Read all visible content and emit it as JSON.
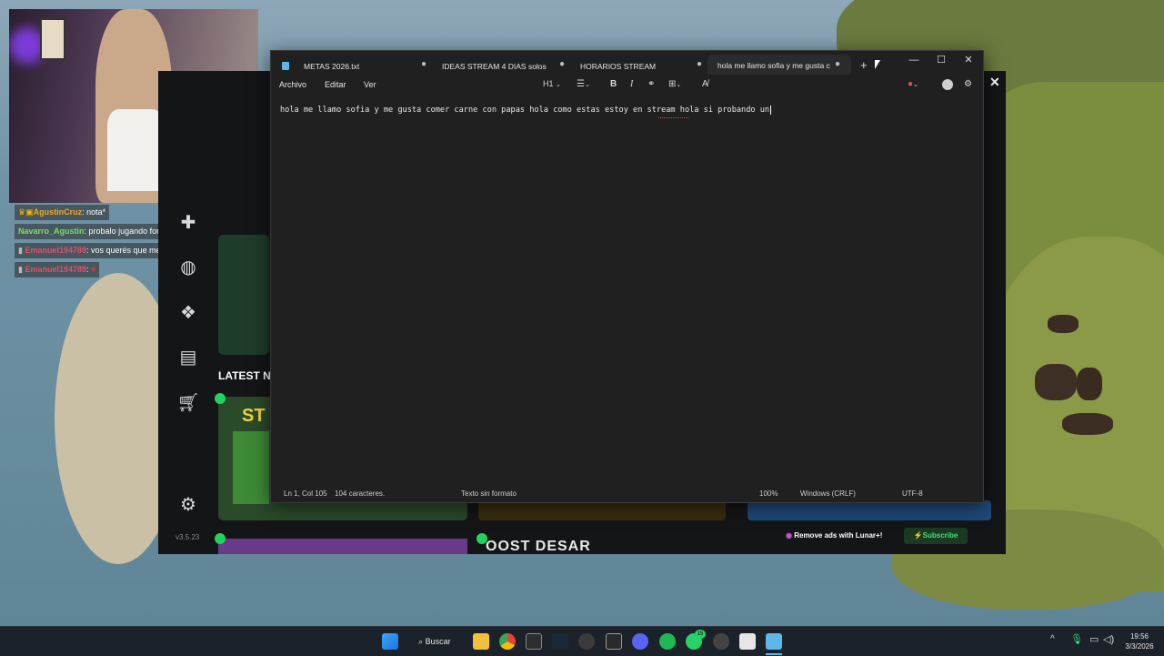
{
  "chat": {
    "messages": [
      {
        "user": "AgustinCruz",
        "text": "nota*"
      },
      {
        "user": "Navarro_Agustin",
        "text": "probalo jugando fornite..."
      },
      {
        "user": "Emanuel194789",
        "text": "vos querés que me duerma?"
      },
      {
        "user": "Emanuel194789",
        "text": ""
      }
    ]
  },
  "launcher": {
    "latest_label": "LATEST N",
    "version": "v3.5.23",
    "remove_ads": "Remove ads with Lunar+!",
    "subscribe": "Subscribe",
    "banner_text": "ST",
    "bottom_text": "OOST DESAR"
  },
  "notepad": {
    "tabs": [
      {
        "label": "METAS 2026.txt"
      },
      {
        "label": "IDEAS STREAM 4 DIAS solos"
      },
      {
        "label": "HORARIOS STREAM"
      },
      {
        "label": "hola me llamo sofia y me gusta c"
      }
    ],
    "menu": {
      "file": "Archivo",
      "edit": "Editar",
      "view": "Ver"
    },
    "toolbar": {
      "heading": "H1"
    },
    "content": "hola me llamo sofia y me gusta comer carne con papas hola como estas estoy en stream hola si probando un",
    "status": {
      "position": "Ln 1, Col 105",
      "chars": "104 caracteres.",
      "format": "Texto sin formato",
      "zoom": "100%",
      "line_ending": "Windows (CRLF)",
      "encoding": "UTF-8"
    }
  },
  "taskbar": {
    "search": "Buscar",
    "time": "19:56",
    "date": "3/3/2026",
    "whatsapp_badge": "15"
  }
}
